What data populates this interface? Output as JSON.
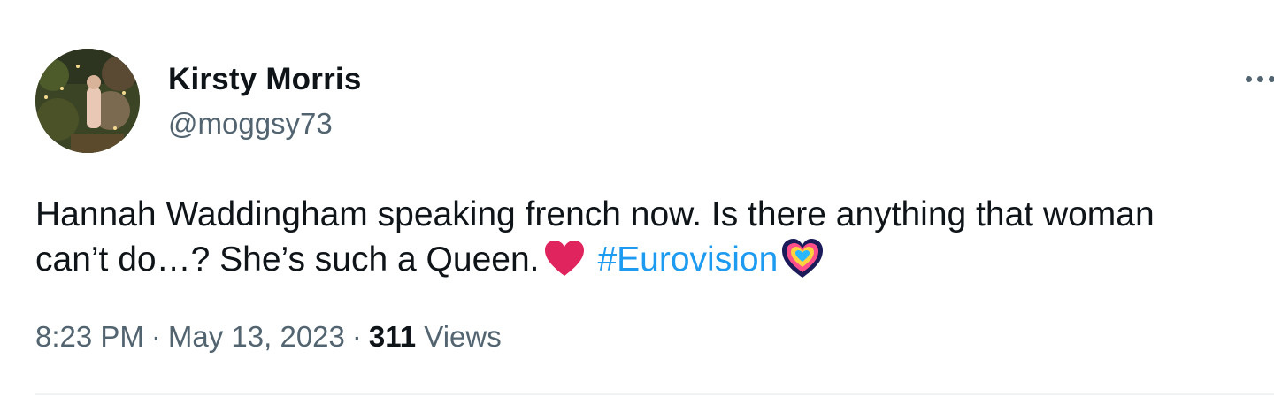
{
  "author": {
    "name": "Kirsty Morris",
    "handle": "@moggsy73"
  },
  "tweet": {
    "text_part1": "Hannah Waddingham speaking french now. Is there anything that woman can’t do…? She’s such a Queen.",
    "hashtag": "#Eurovision",
    "icons": [
      "red-heart-icon",
      "eurovision-hashflag-icon",
      "more-options-icon"
    ]
  },
  "meta": {
    "time": "8:23 PM",
    "separator": "·",
    "date": "May 13, 2023",
    "views_count": "311",
    "views_label": "Views"
  },
  "colors": {
    "text": "#0f1419",
    "secondary": "#536471",
    "link": "#1d9bf0",
    "heart": "#e0245e",
    "divider": "#eff3f4"
  }
}
